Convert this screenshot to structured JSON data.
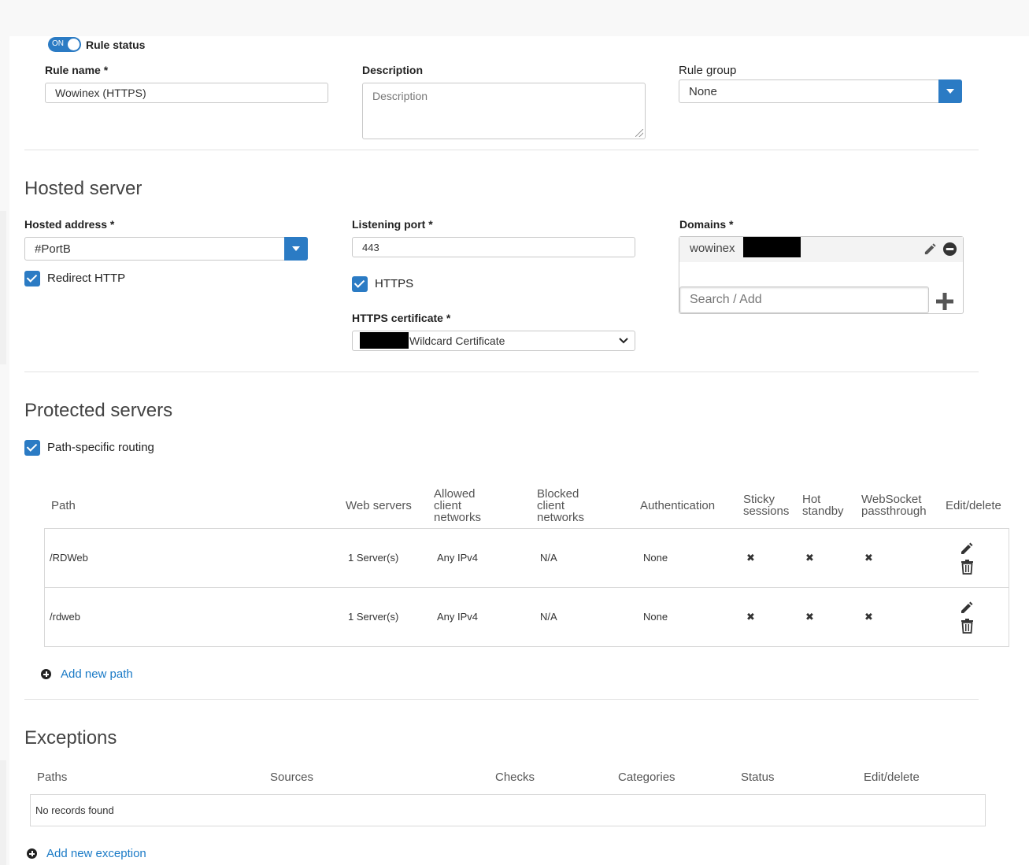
{
  "rule": {
    "status_label": "Rule status",
    "status_toggle": "ON",
    "name_label": "Rule name *",
    "name_value": "Wowinex (HTTPS)",
    "description_label": "Description",
    "description_placeholder": "Description",
    "group_label": "Rule group",
    "group_value": "None"
  },
  "hosted": {
    "title": "Hosted server",
    "address_label": "Hosted address *",
    "address_value": "#PortB",
    "redirect_label": "Redirect HTTP",
    "port_label": "Listening port *",
    "port_value": "443",
    "https_label": "HTTPS",
    "cert_label": "HTTPS certificate *",
    "cert_value": "Wildcard Certificate",
    "domains_label": "Domains *",
    "domain_value": "wowinex",
    "domains_search_placeholder": "Search / Add"
  },
  "protected": {
    "title": "Protected servers",
    "path_routing_label": "Path-specific routing",
    "columns": {
      "path": "Path",
      "web_servers": "Web servers",
      "allowed_line1": "Allowed",
      "allowed_line2": "client",
      "allowed_line3": "networks",
      "blocked_line1": "Blocked",
      "blocked_line2": "client",
      "blocked_line3": "networks",
      "authentication": "Authentication",
      "sticky_line1": "Sticky",
      "sticky_line2": "sessions",
      "hot_line1": "Hot",
      "hot_line2": "standby",
      "ws_line1": "WebSocket",
      "ws_line2": "passthrough",
      "edit_delete": "Edit/delete"
    },
    "rows": [
      {
        "path": "/RDWeb",
        "servers": "1 Server(s)",
        "allowed": "Any IPv4",
        "blocked": "N/A",
        "auth": "None",
        "sticky": "✖",
        "hot": "✖",
        "ws": "✖"
      },
      {
        "path": "/rdweb",
        "servers": "1 Server(s)",
        "allowed": "Any IPv4",
        "blocked": "N/A",
        "auth": "None",
        "sticky": "✖",
        "hot": "✖",
        "ws": "✖"
      }
    ],
    "add_path": "Add new path"
  },
  "exceptions": {
    "title": "Exceptions",
    "columns": {
      "paths": "Paths",
      "sources": "Sources",
      "checks": "Checks",
      "categories": "Categories",
      "status": "Status",
      "edit_delete": "Edit/delete"
    },
    "empty": "No records found",
    "add_exception": "Add new exception"
  },
  "colors": {
    "accent": "#2b7bc4",
    "link": "#1a7ac6"
  },
  "icons": [
    "pencil-icon",
    "trash-icon",
    "minus-circle-icon",
    "plus-icon",
    "plus-circle-icon",
    "x-mark-icon",
    "chevron-down-icon"
  ]
}
